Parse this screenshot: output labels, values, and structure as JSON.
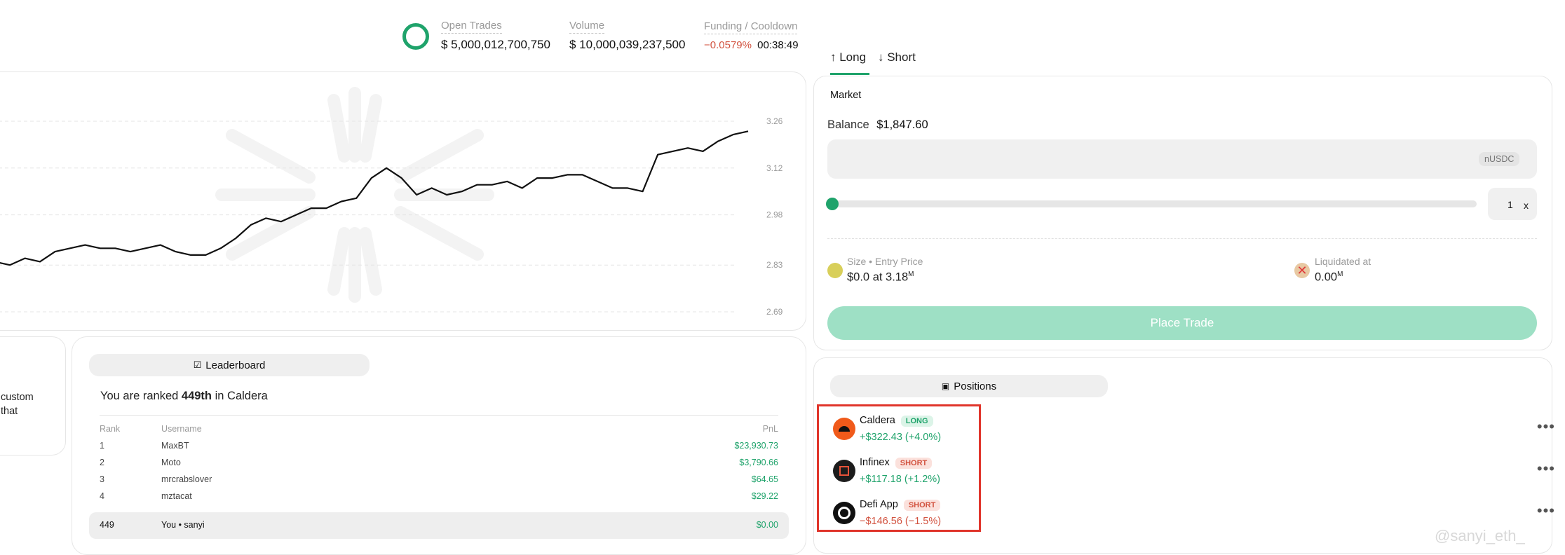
{
  "stats": {
    "open_trades_label": "Open Trades",
    "open_trades_value": "$ 5,000,012,700,750",
    "volume_label": "Volume",
    "volume_value": "$ 10,000,039,237,500",
    "funding_label": "Funding / Cooldown",
    "funding_rate": "−0.0579%",
    "cooldown": "00:38:49"
  },
  "trade": {
    "tab_long": "↑ Long",
    "tab_short": "↓ Short",
    "order_type": "Market",
    "balance_label": "Balance",
    "balance_value": "$1,847.60",
    "amount_unit": "nUSDC",
    "leverage_value": "1",
    "leverage_suffix": "x",
    "leverage_fraction": 0,
    "size_label": "Size • Entry Price",
    "size_value": "$0.0 at 3.18",
    "size_sup": "M",
    "liq_label": "Liquidated at",
    "liq_value": "0.00",
    "liq_sup": "M",
    "place_trade": "Place Trade"
  },
  "chart_data": {
    "type": "line",
    "y_ticks": [
      "3.26",
      "3.12",
      "2.98",
      "2.83",
      "2.69"
    ],
    "ylim": [
      2.69,
      3.26
    ],
    "grid": true,
    "series": [
      {
        "values": [
          2.84,
          2.84,
          2.83,
          2.85,
          2.84,
          2.87,
          2.88,
          2.89,
          2.88,
          2.88,
          2.87,
          2.88,
          2.89,
          2.87,
          2.86,
          2.86,
          2.88,
          2.91,
          2.95,
          2.97,
          2.96,
          2.98,
          3.0,
          3.0,
          3.02,
          3.03,
          3.09,
          3.12,
          3.09,
          3.04,
          3.06,
          3.04,
          3.05,
          3.07,
          3.07,
          3.08,
          3.06,
          3.09,
          3.09,
          3.1,
          3.1,
          3.08,
          3.06,
          3.06,
          3.05,
          3.16,
          3.17,
          3.18,
          3.17,
          3.2,
          3.22,
          3.23
        ]
      }
    ]
  },
  "partial_panel": {
    "line1": "custom",
    "line2": "that"
  },
  "leaderboard": {
    "button_label": "Leaderboard",
    "rank_prefix": "You are ranked ",
    "rank_value": "449th",
    "rank_suffix": " in Caldera",
    "col_rank": "Rank",
    "col_user": "Username",
    "col_pnl": "PnL",
    "rows": [
      {
        "rank": "1",
        "user": "MaxBT",
        "pnl": "$23,930.73"
      },
      {
        "rank": "2",
        "user": "Moto",
        "pnl": "$3,790.66"
      },
      {
        "rank": "3",
        "user": "mrcrabslover",
        "pnl": "$64.65"
      },
      {
        "rank": "4",
        "user": "mztacat",
        "pnl": "$29.22"
      }
    ],
    "self": {
      "rank": "449",
      "user": "You • sanyi",
      "pnl": "$0.00"
    }
  },
  "positions": {
    "button_label": "Positions",
    "items": [
      {
        "name": "Caldera",
        "side": "LONG",
        "pnl": "+$322.43 (+4.0%)"
      },
      {
        "name": "Infinex",
        "side": "SHORT",
        "pnl": "+$117.18 (+1.2%)"
      },
      {
        "name": "Defi App",
        "side": "SHORT",
        "pnl": "−$146.56 (−1.5%)"
      }
    ],
    "more": "•••"
  },
  "watermark": "@sanyi_eth_",
  "colors": {
    "accent_green": "#1fa36b",
    "negative_red": "#d2523f",
    "highlight_box": "#e0352b",
    "place_trade_bg": "#9ee0c5"
  }
}
